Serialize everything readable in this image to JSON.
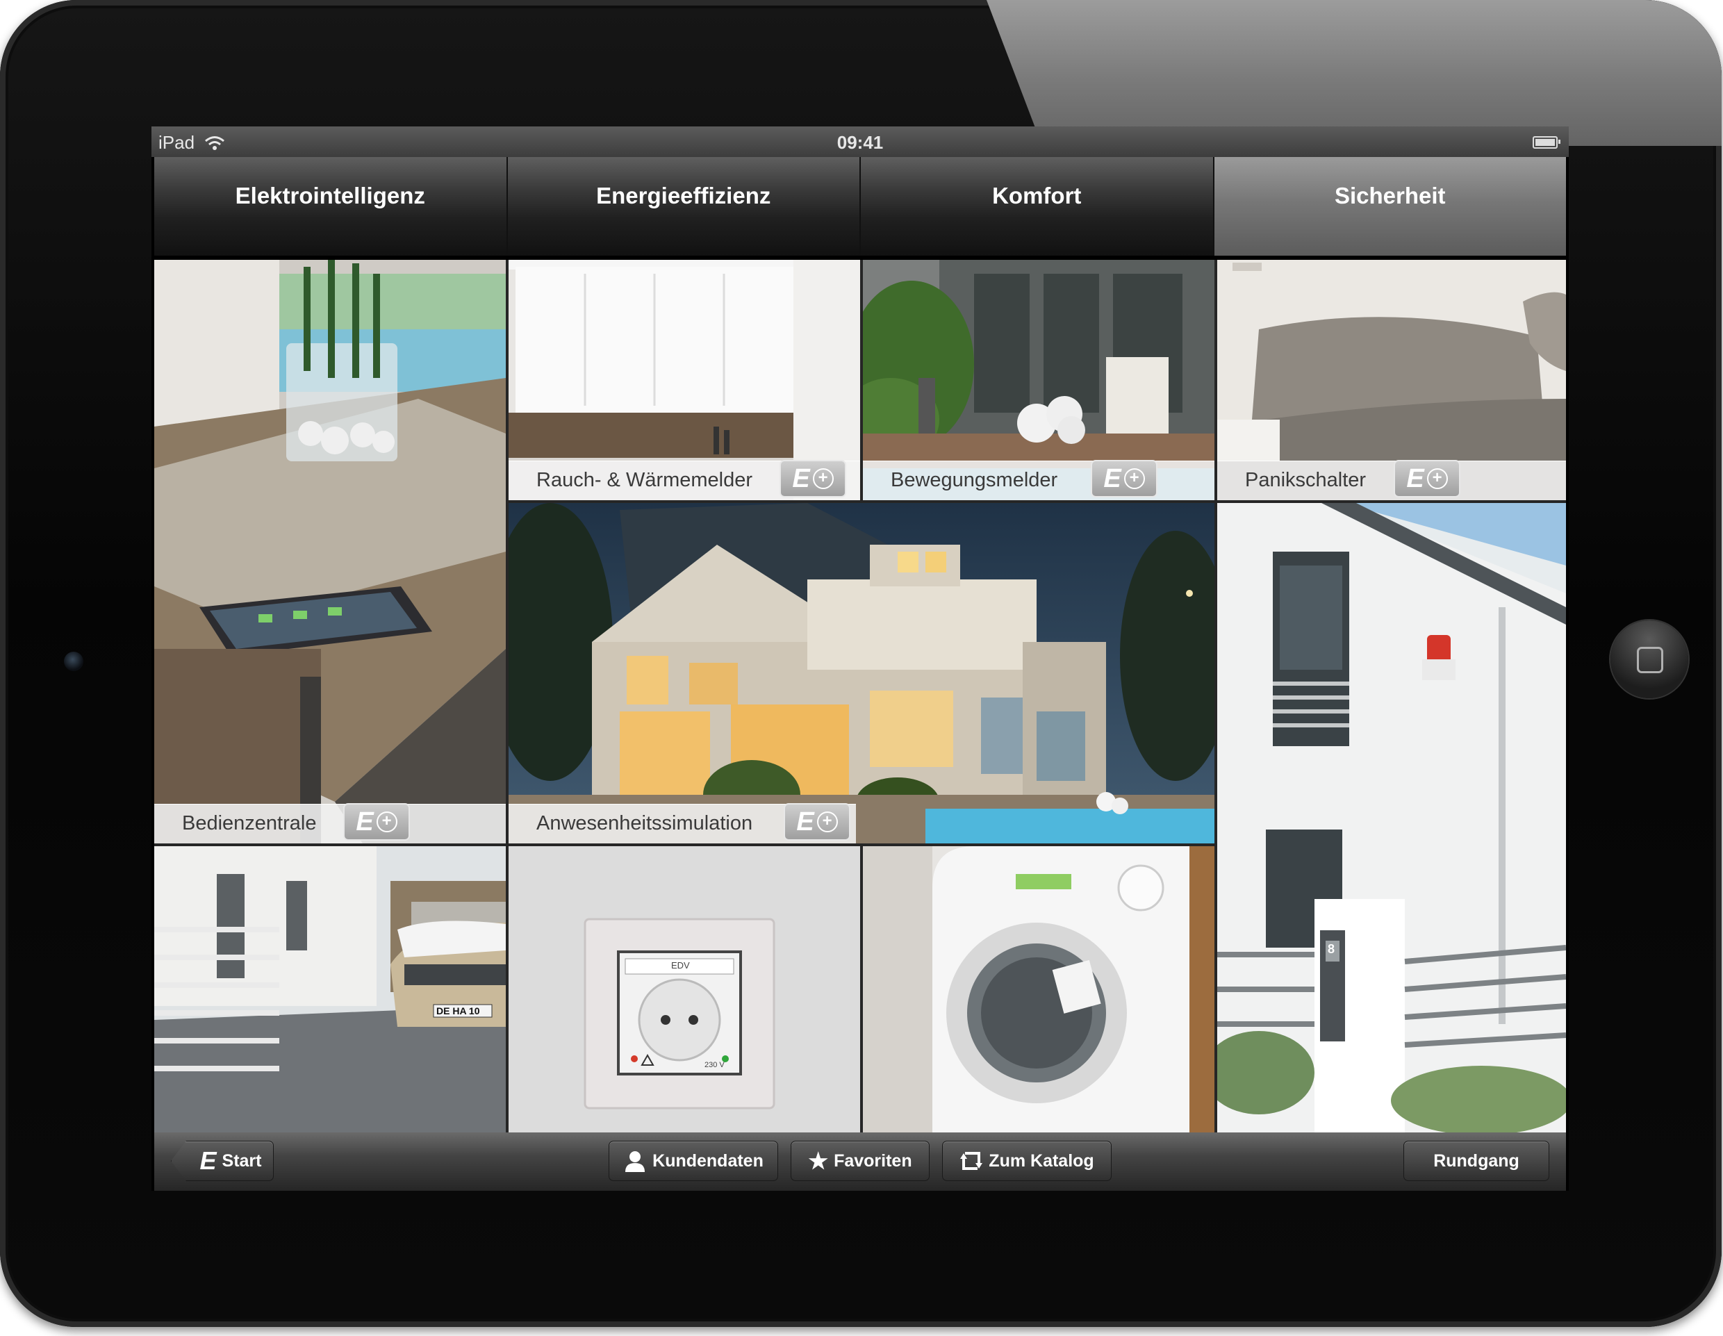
{
  "status_bar": {
    "device": "iPad",
    "time": "09:41"
  },
  "tabs": [
    {
      "label": "Elektrointelligenz"
    },
    {
      "label": "Energieeffizienz"
    },
    {
      "label": "Komfort"
    },
    {
      "label": "Sicherheit",
      "active": true
    }
  ],
  "tiles": {
    "rauch": {
      "label": "Rauch- & Wärmemelder"
    },
    "bewegung": {
      "label": "Bewegungsmelder"
    },
    "panik": {
      "label": "Panikschalter"
    },
    "bedien": {
      "label": "Bedienzentrale"
    },
    "anwesenheit": {
      "label": "Anwesenheitssimulation"
    },
    "car_plate": "DE HA 10",
    "socket_text": "EDV",
    "socket_volt": "230 V",
    "intercom_number": "8"
  },
  "eplus": {
    "letter": "E",
    "plus": "+"
  },
  "toolbar": {
    "start": "Start",
    "kundendaten": "Kundendaten",
    "favoriten": "Favoriten",
    "zum_katalog": "Zum Katalog",
    "rundgang": "Rundgang"
  },
  "colors": {
    "active_tab": "#777777",
    "frame": "#0a0a0a",
    "label_bar": "#f2f2f2"
  },
  "icons": [
    "wifi-icon",
    "battery-icon",
    "e-plus-icon",
    "user-icon",
    "star-icon",
    "refresh-icon",
    "camera-icon",
    "home-button-icon"
  ]
}
